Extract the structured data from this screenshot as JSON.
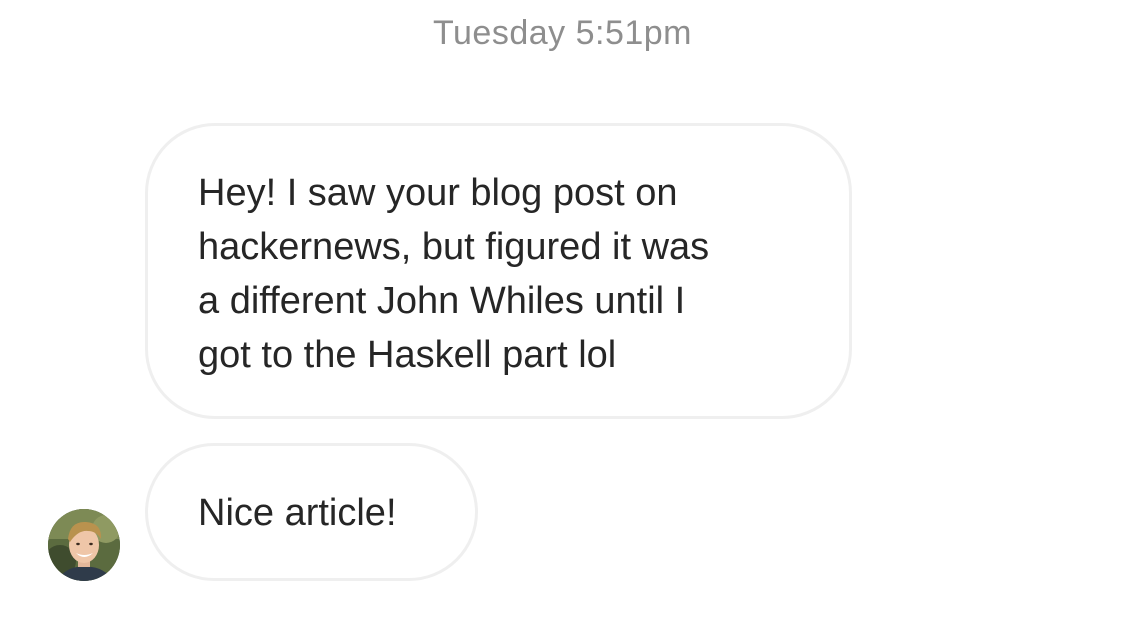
{
  "thread": {
    "timestamp": "Tuesday 5:51pm",
    "messages": [
      {
        "lines": [
          "Hey! I saw your blog post on",
          "hackernews, but figured it was",
          "a different John Whiles until I",
          "got to the Haskell part lol"
        ]
      },
      {
        "lines": [
          "Nice article!"
        ]
      }
    ],
    "avatar": {
      "icon": "user-avatar-photo"
    }
  }
}
